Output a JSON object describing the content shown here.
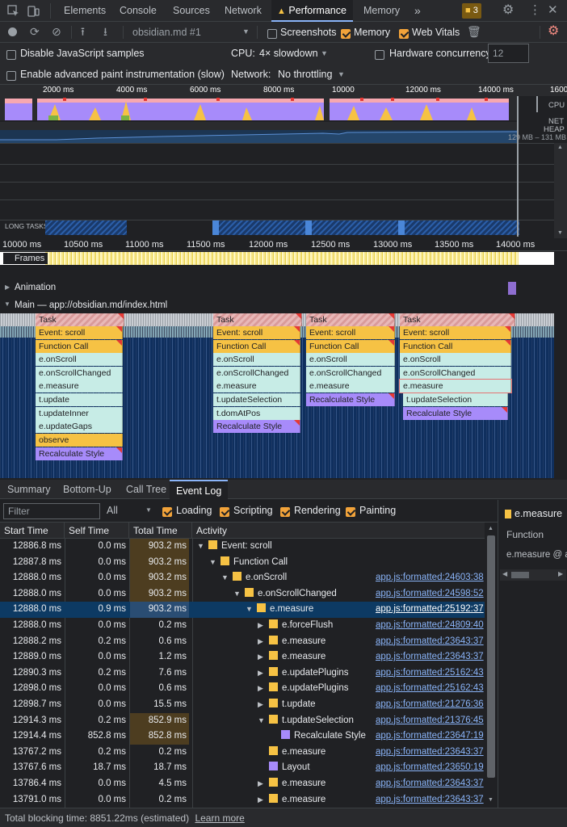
{
  "tabs": {
    "elements": "Elements",
    "console": "Console",
    "sources": "Sources",
    "network": "Network",
    "performance": "Performance",
    "memory": "Memory",
    "issues_count": "3"
  },
  "toolbar": {
    "profile_select": "obsidian.md #1",
    "screenshots": "Screenshots",
    "memory": "Memory",
    "web_vitals": "Web Vitals",
    "disable_js_samples": "Disable JavaScript samples",
    "cpu_label": "CPU:",
    "cpu_value": "4× slowdown",
    "hardware_concurrency": "Hardware concurrency",
    "hardware_value": "12",
    "advanced_paint": "Enable advanced paint instrumentation (slow)",
    "network_label": "Network:",
    "network_value": "No throttling"
  },
  "overview": {
    "ruler": [
      "2000 ms",
      "4000 ms",
      "6000 ms",
      "8000 ms",
      "10000",
      "12000 ms",
      "14000 ms",
      "1600"
    ],
    "cpu_label": "CPU",
    "net_label": "NET",
    "heap_label": "HEAP",
    "heap_range": "129 MB – 131 MB",
    "long_tasks": "LONG TASKS"
  },
  "timeline": {
    "ticks": [
      "10000 ms",
      "10500 ms",
      "11000 ms",
      "11500 ms",
      "12000 ms",
      "12500 ms",
      "13000 ms",
      "13500 ms",
      "14000 ms"
    ],
    "frames": "Frames",
    "animation": "Animation",
    "main": "Main — app://obsidian.md/index.html"
  },
  "flame": {
    "col1": [
      "Task",
      "Event: scroll",
      "Function Call",
      "e.onScroll",
      "e.onScrollChanged",
      "e.measure",
      "t.update",
      "t.updateInner",
      "e.updateGaps",
      "observe",
      "Recalculate Style"
    ],
    "col2": [
      "Task",
      "Event: scroll",
      "Function Call",
      "e.onScroll",
      "e.onScrollChanged",
      "e.measure",
      "t.updateSelection",
      "t.domAtPos",
      "Recalculate Style"
    ],
    "col3": [
      "Task",
      "Event: scroll",
      "Function Call",
      "e.onScroll",
      "e.onScrollChanged",
      "e.measure",
      "Recalculate Style"
    ],
    "col4": [
      "Task",
      "Event: scroll",
      "Function Call",
      "e.onScroll",
      "e.onScrollChanged",
      "e.measure",
      "t.updateSelection",
      "Recalculate Style"
    ]
  },
  "bottom_tabs": {
    "summary": "Summary",
    "bottom_up": "Bottom-Up",
    "call_tree": "Call Tree",
    "event_log": "Event Log"
  },
  "filters": {
    "filter_placeholder": "Filter",
    "all": "All",
    "loading": "Loading",
    "scripting": "Scripting",
    "rendering": "Rendering",
    "painting": "Painting"
  },
  "table": {
    "headers": {
      "start": "Start Time",
      "self": "Self Time",
      "total": "Total Time",
      "activity": "Activity"
    },
    "rows": [
      {
        "start": "12886.8 ms",
        "self": "0.0 ms",
        "total": "903.2 ms",
        "activity": "Event: scroll",
        "link": ""
      },
      {
        "start": "12887.8 ms",
        "self": "0.0 ms",
        "total": "903.2 ms",
        "activity": "Function Call",
        "link": ""
      },
      {
        "start": "12888.0 ms",
        "self": "0.0 ms",
        "total": "903.2 ms",
        "activity": "e.onScroll",
        "link": "app.js:formatted:24603:38"
      },
      {
        "start": "12888.0 ms",
        "self": "0.0 ms",
        "total": "903.2 ms",
        "activity": "e.onScrollChanged",
        "link": "app.js:formatted:24598:52"
      },
      {
        "start": "12888.0 ms",
        "self": "0.9 ms",
        "total": "903.2 ms",
        "activity": "e.measure",
        "link": "app.js:formatted:25192:37"
      },
      {
        "start": "12888.0 ms",
        "self": "0.0 ms",
        "total": "0.2 ms",
        "activity": "e.forceFlush",
        "link": "app.js:formatted:24809:40"
      },
      {
        "start": "12888.2 ms",
        "self": "0.2 ms",
        "total": "0.6 ms",
        "activity": "e.measure",
        "link": "app.js:formatted:23643:37"
      },
      {
        "start": "12889.0 ms",
        "self": "0.0 ms",
        "total": "1.2 ms",
        "activity": "e.measure",
        "link": "app.js:formatted:23643:37"
      },
      {
        "start": "12890.3 ms",
        "self": "0.2 ms",
        "total": "7.6 ms",
        "activity": "e.updatePlugins",
        "link": "app.js:formatted:25162:43"
      },
      {
        "start": "12898.0 ms",
        "self": "0.0 ms",
        "total": "0.6 ms",
        "activity": "e.updatePlugins",
        "link": "app.js:formatted:25162:43"
      },
      {
        "start": "12898.7 ms",
        "self": "0.0 ms",
        "total": "15.5 ms",
        "activity": "t.update",
        "link": "app.js:formatted:21276:36"
      },
      {
        "start": "12914.3 ms",
        "self": "0.2 ms",
        "total": "852.9 ms",
        "activity": "t.updateSelection",
        "link": "app.js:formatted:21376:45"
      },
      {
        "start": "12914.4 ms",
        "self": "852.8 ms",
        "total": "852.8 ms",
        "activity": "Recalculate Style",
        "link": "app.js:formatted:23647:19"
      },
      {
        "start": "13767.2 ms",
        "self": "0.2 ms",
        "total": "0.2 ms",
        "activity": "e.measure",
        "link": "app.js:formatted:23643:37"
      },
      {
        "start": "13767.6 ms",
        "self": "18.7 ms",
        "total": "18.7 ms",
        "activity": "Layout",
        "link": "app.js:formatted:23650:19"
      },
      {
        "start": "13786.4 ms",
        "self": "0.0 ms",
        "total": "4.5 ms",
        "activity": "e.measure",
        "link": "app.js:formatted:23643:37"
      },
      {
        "start": "13791.0 ms",
        "self": "0.0 ms",
        "total": "0.2 ms",
        "activity": "e.measure",
        "link": "app.js:formatted:23643:37"
      }
    ]
  },
  "details": {
    "title": "e.measure",
    "type": "Function",
    "source": "e.measure @ ap"
  },
  "footer": {
    "blocking": "Total blocking time: 8851.22ms (estimated)",
    "learn_more": "Learn more"
  }
}
